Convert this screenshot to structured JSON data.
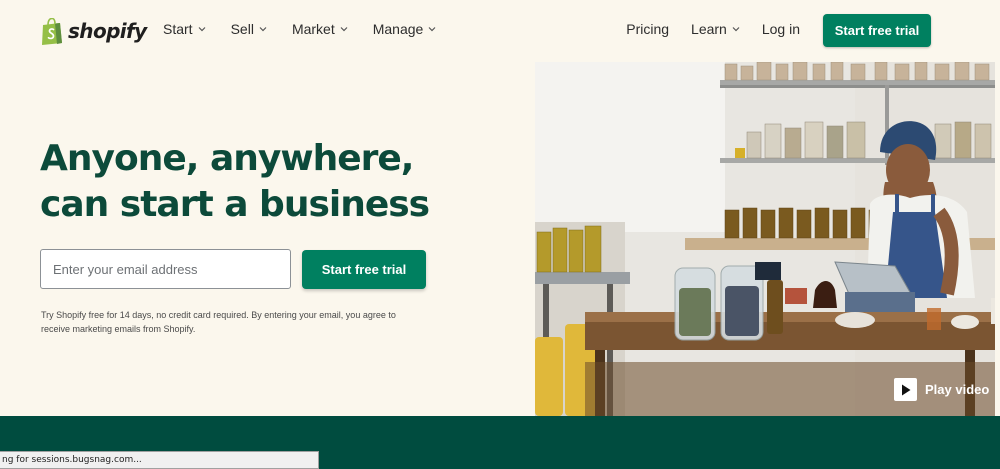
{
  "brand": {
    "name": "shopify",
    "color": "#95bf47"
  },
  "nav": {
    "left": [
      {
        "label": "Start",
        "icon": "chevron-down-icon"
      },
      {
        "label": "Sell",
        "icon": "chevron-down-icon"
      },
      {
        "label": "Market",
        "icon": "chevron-down-icon"
      },
      {
        "label": "Manage",
        "icon": "chevron-down-icon"
      }
    ],
    "right": {
      "pricing": "Pricing",
      "learn": "Learn",
      "login": "Log in"
    },
    "cta": "Start free trial"
  },
  "hero": {
    "title_line1": "Anyone, anywhere,",
    "title_line2": "can start a business",
    "email_placeholder": "Enter your email address",
    "cta": "Start free trial",
    "disclaimer": "Try Shopify free for 14 days, no credit card required. By entering your email, you agree to receive marketing emails from Shopify.",
    "play_video": "Play video"
  },
  "status_bar": {
    "text": "ng for sessions.bugsnag.com..."
  },
  "colors": {
    "accent": "#008060",
    "heading": "#0c4a3a",
    "background": "#fbf7ed",
    "band": "#004c3f"
  }
}
